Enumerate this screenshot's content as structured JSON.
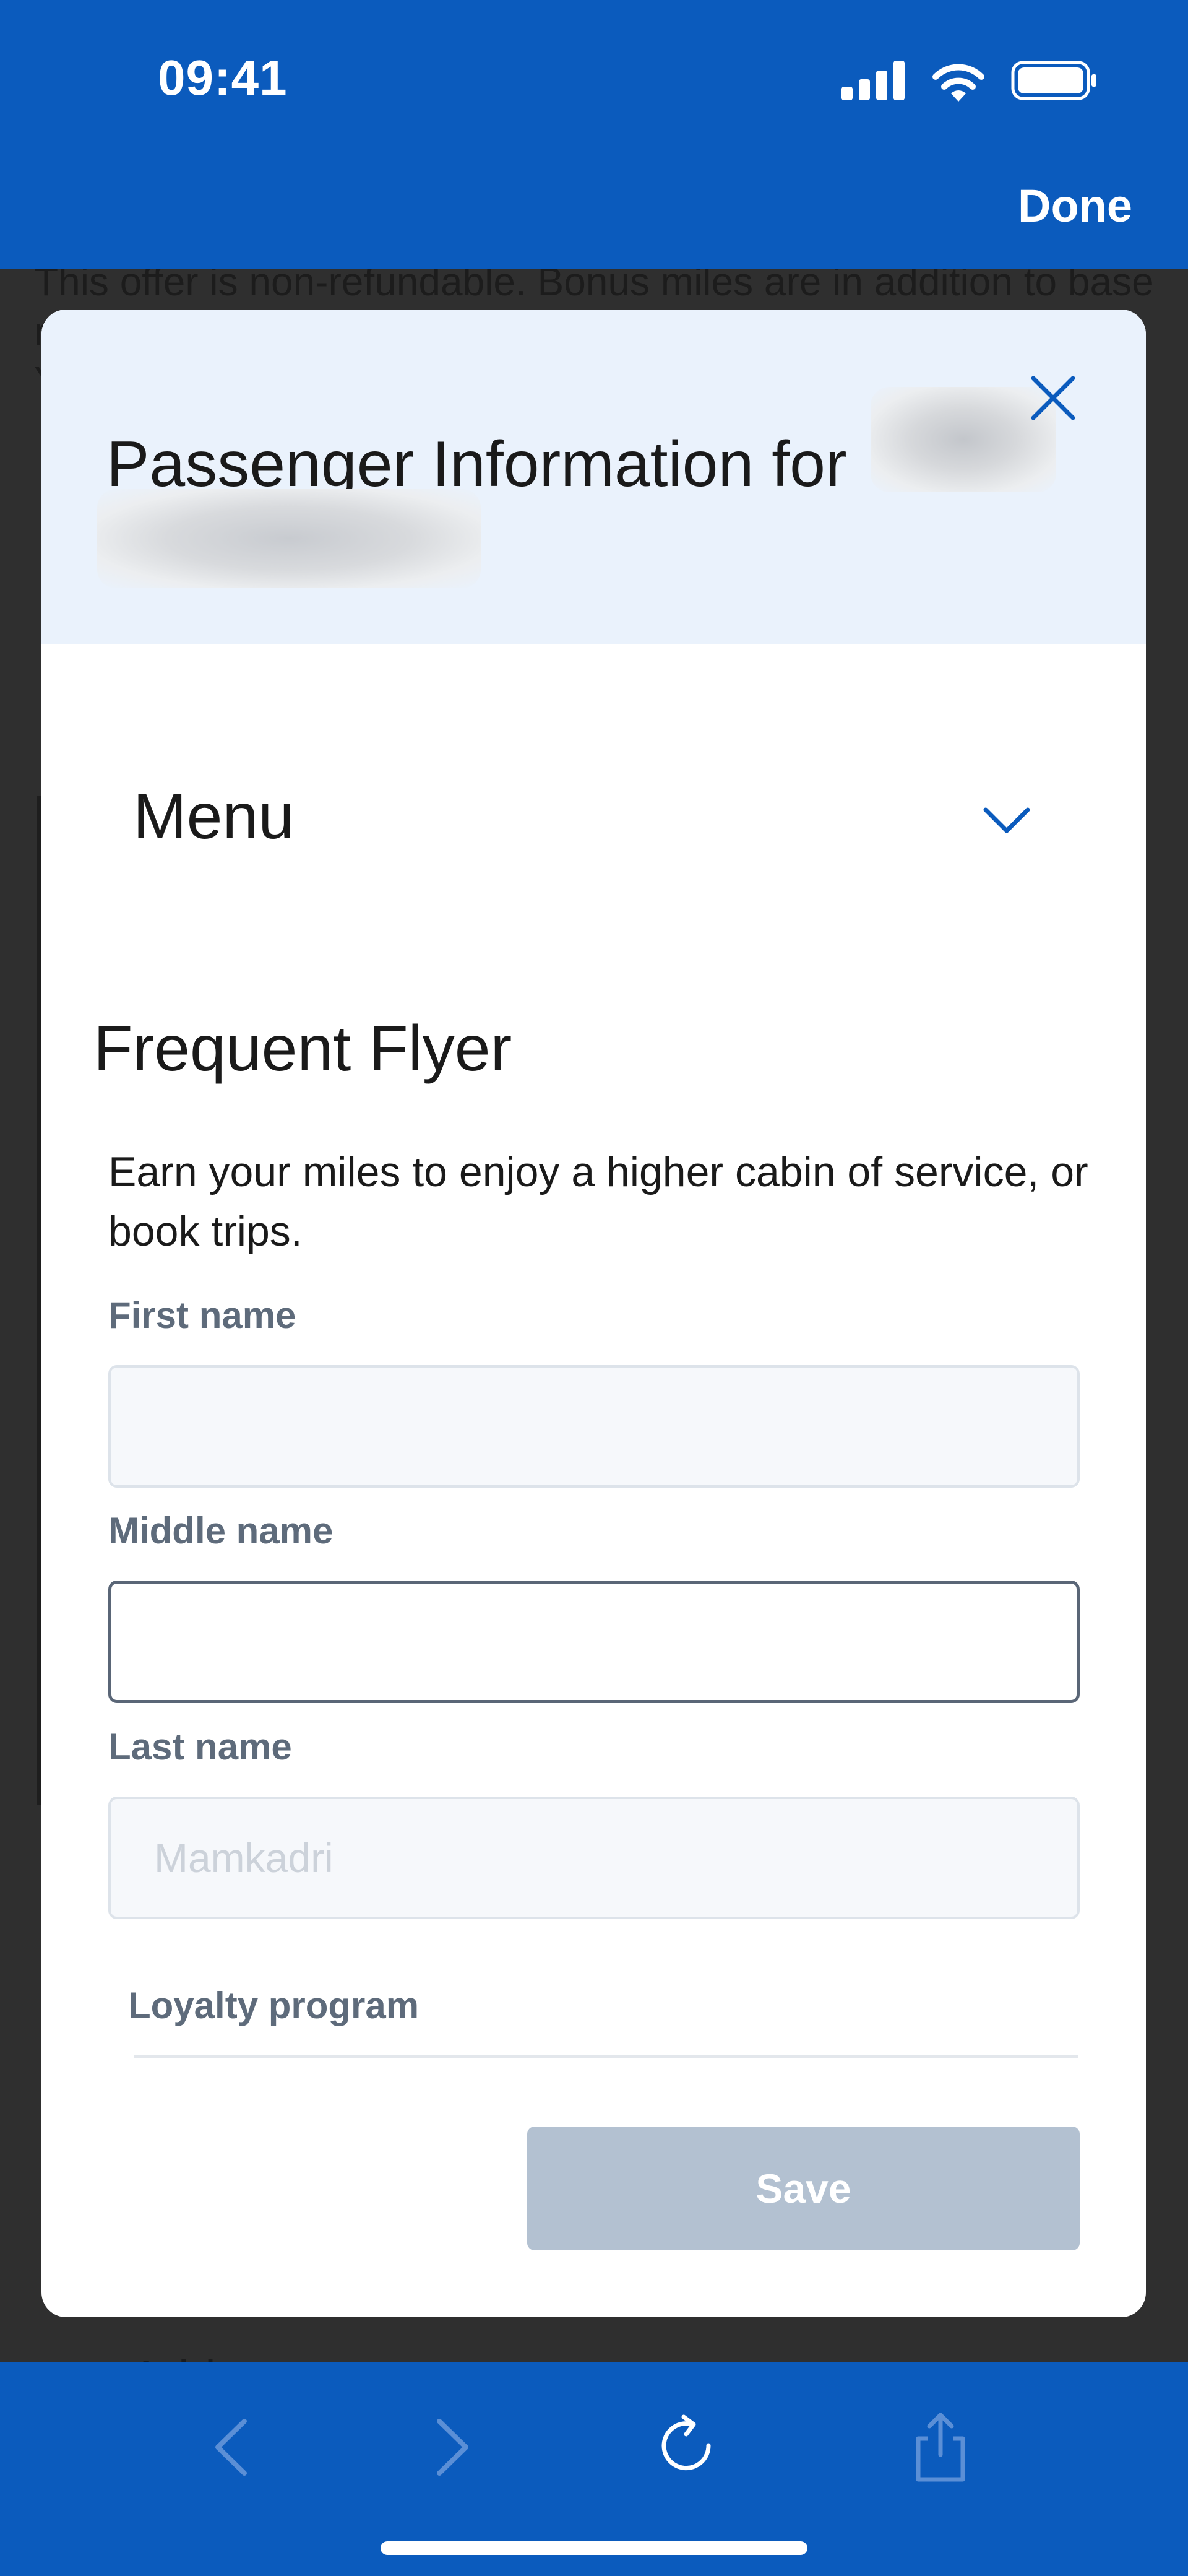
{
  "status_bar": {
    "time": "09:41"
  },
  "browser": {
    "done_label": "Done"
  },
  "background_page": {
    "text": "This offer is non-refundable. Bonus miles are in addition to base miles earned and don't count toward elite status qualification. Your bank or",
    "bottom_text": "Add a carry-on pet"
  },
  "modal": {
    "title": "Passenger Information for",
    "menu_label": "Menu",
    "section": {
      "heading": "Frequent Flyer",
      "description": "Earn your miles to enjoy a higher cabin of service, or book trips."
    },
    "fields": {
      "first_name": {
        "label": "First name",
        "value": ""
      },
      "middle_name": {
        "label": "Middle name",
        "value": ""
      },
      "last_name": {
        "label": "Last name",
        "placeholder": "Mamkadri"
      }
    },
    "loyalty_program_label": "Loyalty program",
    "save_label": "Save"
  },
  "colors": {
    "brand_blue": "#0b5bbd",
    "header_tint": "#eaf2fc",
    "save_disabled": "#b3c1d1",
    "label_gray": "#5e6b7b"
  },
  "icons": {
    "status": [
      "signal-icon",
      "wifi-icon",
      "battery-icon"
    ],
    "modal": [
      "close-icon",
      "chevron-down-icon"
    ],
    "toolbar": [
      "back-icon",
      "forward-icon",
      "reload-icon",
      "share-icon"
    ]
  }
}
